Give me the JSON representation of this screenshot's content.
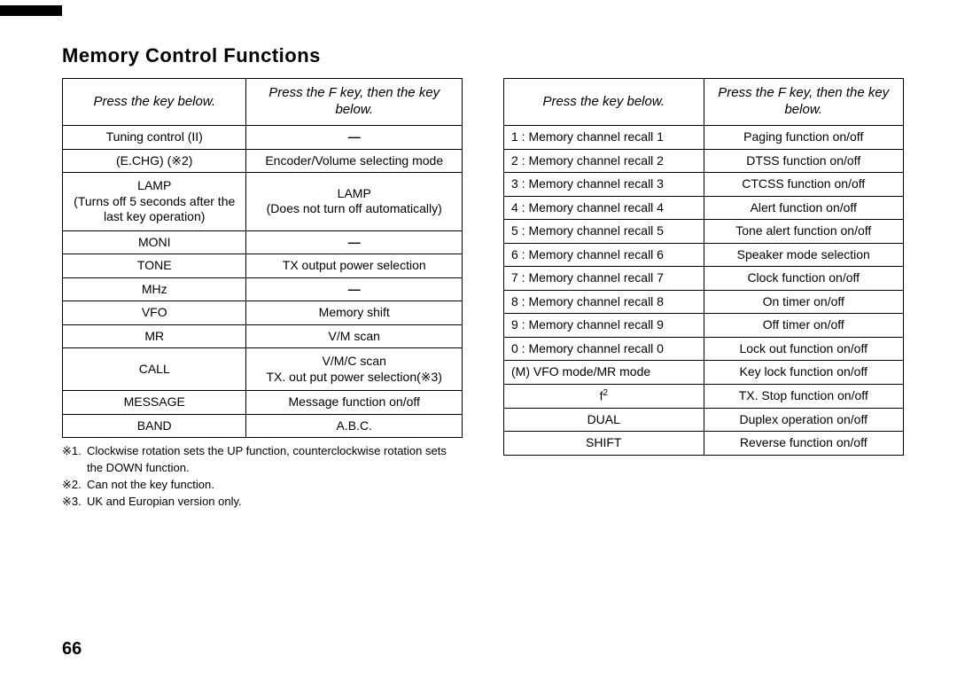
{
  "heading": "Memory Control Functions",
  "col_headers": {
    "left": "Press the key below.",
    "right": "Press the F key, then the key below."
  },
  "table_left": [
    {
      "l": "Tuning control (II)",
      "r": "—",
      "dash": true
    },
    {
      "l": "(E.CHG) (※2)",
      "r": "Encoder/Volume selecting mode"
    },
    {
      "l": "LAMP\n(Turns off 5 seconds after the last key operation)",
      "r": "LAMP\n(Does not turn off automatically)",
      "tall": true
    },
    {
      "l": "MONI",
      "r": "—",
      "dash": true
    },
    {
      "l": "TONE",
      "r": "TX output power selection"
    },
    {
      "l": "MHz",
      "r": "—",
      "dash": true
    },
    {
      "l": "VFO",
      "r": "Memory shift"
    },
    {
      "l": "MR",
      "r": "V/M scan"
    },
    {
      "l": "CALL",
      "r": "V/M/C scan\nTX. out put power selection(※3)",
      "tall": true
    },
    {
      "l": "MESSAGE",
      "r": "Message function on/off"
    },
    {
      "l": "BAND",
      "r": "A.B.C."
    }
  ],
  "table_right": [
    {
      "l": "1 : Memory channel recall 1",
      "r": "Paging function on/off"
    },
    {
      "l": "2 : Memory channel recall 2",
      "r": "DTSS function on/off"
    },
    {
      "l": "3 : Memory channel recall 3",
      "r": "CTCSS function on/off"
    },
    {
      "l": "4 : Memory channel recall 4",
      "r": "Alert function on/off"
    },
    {
      "l": "5 : Memory channel recall 5",
      "r": "Tone alert function on/off"
    },
    {
      "l": "6 : Memory channel recall 6",
      "r": "Speaker mode selection"
    },
    {
      "l": "7 : Memory channel recall 7",
      "r": "Clock function on/off"
    },
    {
      "l": "8 : Memory channel recall 8",
      "r": "On timer on/off"
    },
    {
      "l": "9 : Memory channel recall 9",
      "r": "Off timer on/off"
    },
    {
      "l": "0 : Memory channel recall 0",
      "r": "Lock out function on/off"
    },
    {
      "l": "(M) VFO mode/MR mode",
      "r": "Key lock function on/off"
    },
    {
      "l": "f²",
      "r": "TX. Stop function on/off",
      "sup": true
    },
    {
      "l": "DUAL",
      "r": "Duplex operation on/off"
    },
    {
      "l": "SHIFT",
      "r": "Reverse function on/off"
    }
  ],
  "notes": [
    {
      "sym": "※1.",
      "txt": "Clockwise rotation sets the UP function, counterclockwise rotation sets the DOWN function."
    },
    {
      "sym": "※2.",
      "txt": "Can not the key function."
    },
    {
      "sym": "※3.",
      "txt": "UK and Europian version only."
    }
  ],
  "page_number": "66"
}
